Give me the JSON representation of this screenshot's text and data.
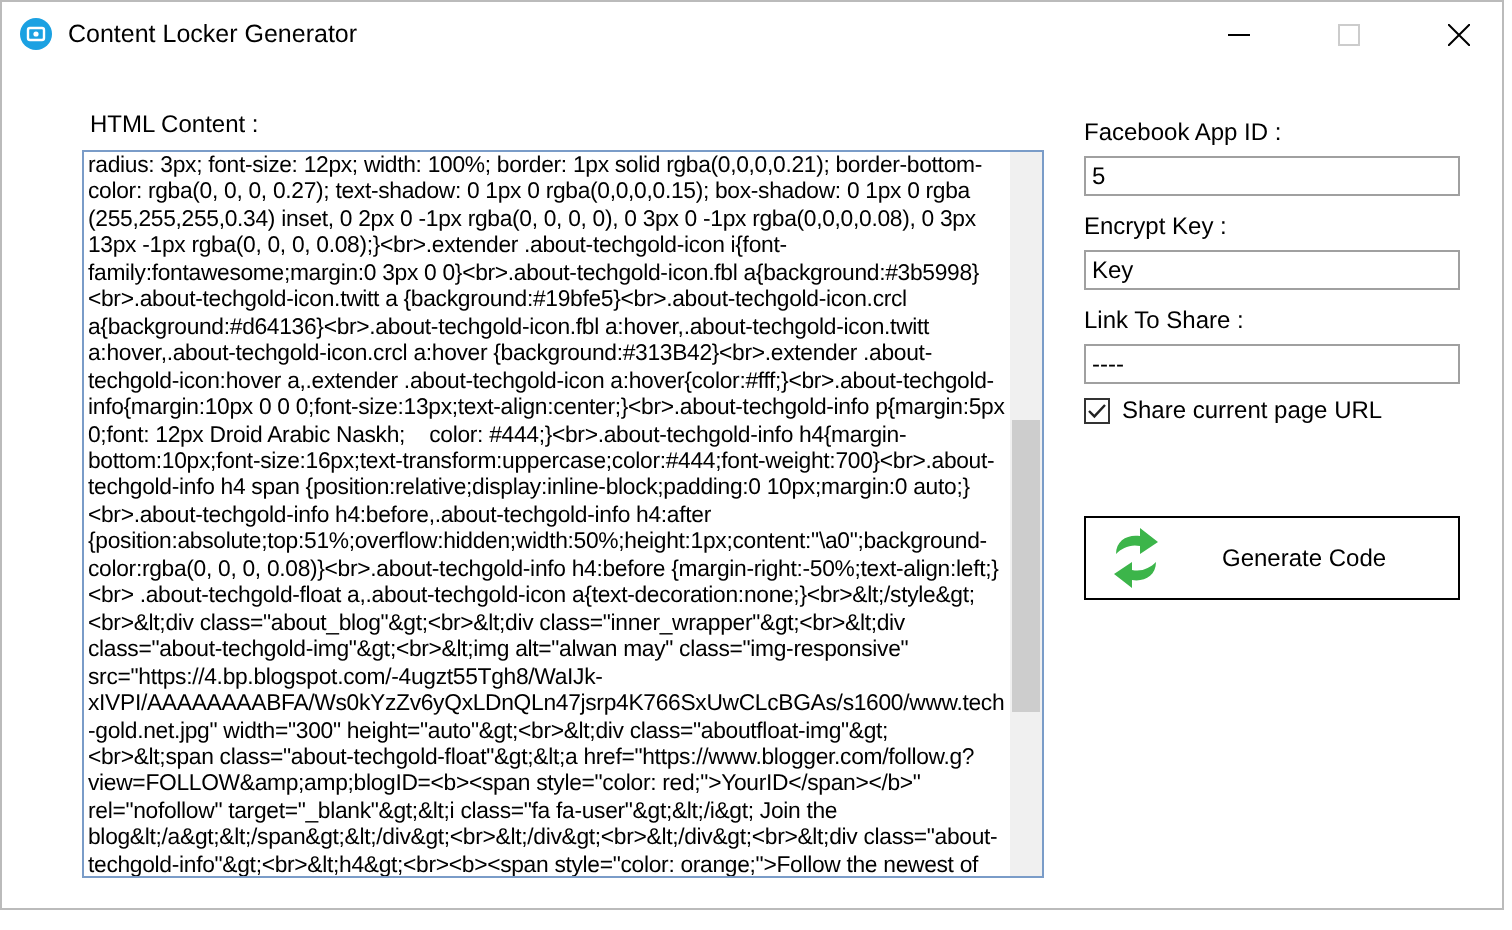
{
  "window": {
    "title": "Content Locker Generator"
  },
  "html_content": {
    "label": "HTML Content :",
    "value": "radius: 3px; font-size: 12px; width: 100%; border: 1px solid rgba(0,0,0,0.21); border-bottom-color: rgba(0, 0, 0, 0.27); text-shadow: 0 1px 0 rgba(0,0,0,0.15); box-shadow: 0 1px 0 rgba (255,255,255,0.34) inset, 0 2px 0 -1px rgba(0, 0, 0, 0), 0 3px 0 -1px rgba(0,0,0,0.08), 0 3px 13px -1px rgba(0, 0, 0, 0.08);}<br>.extender .about-techgold-icon i{font-family:fontawesome;margin:0 3px 0 0}<br>.about-techgold-icon.fbl a{background:#3b5998}<br>.about-techgold-icon.twitt a {background:#19bfe5}<br>.about-techgold-icon.crcl a{background:#d64136}<br>.about-techgold-icon.fbl a:hover,.about-techgold-icon.twitt a:hover,.about-techgold-icon.crcl a:hover {background:#313B42}<br>.extender .about-techgold-icon:hover a,.extender .about-techgold-icon a:hover{color:#fff;}<br>.about-techgold-info{margin:10px 0 0 0;font-size:13px;text-align:center;}<br>.about-techgold-info p{margin:5px 0;font: 12px Droid Arabic Naskh;    color: #444;}<br>.about-techgold-info h4{margin-bottom:10px;font-size:16px;text-transform:uppercase;color:#444;font-weight:700}<br>.about-techgold-info h4 span {position:relative;display:inline-block;padding:0 10px;margin:0 auto;}<br>.about-techgold-info h4:before,.about-techgold-info h4:after {position:absolute;top:51%;overflow:hidden;width:50%;height:1px;content:\"\\a0\";background-color:rgba(0, 0, 0, 0.08)}<br>.about-techgold-info h4:before {margin-right:-50%;text-align:left;}<br> .about-techgold-float a,.about-techgold-icon a{text-decoration:none;}<br>&lt;/style&gt;<br>&lt;div class=\"about_blog\"&gt;<br>&lt;div class=\"inner_wrapper\"&gt;<br>&lt;div class=\"about-techgold-img\"&gt;<br>&lt;img alt=\"alwan may\" class=\"img-responsive\" src=\"https://4.bp.blogspot.com/-4ugzt55Tgh8/WaIJk-xIVPI/AAAAAAAABFA/Ws0kYzZv6yQxLDnQLn47jsrp4K766SxUwCLcBGAs/s1600/www.tech-gold.net.jpg\" width=\"300\" height=\"auto\"&gt;<br>&lt;div class=\"aboutfloat-img\"&gt;<br>&lt;span class=\"about-techgold-float\"&gt;&lt;a href=\"https://www.blogger.com/follow.g?view=FOLLOW&amp;amp;blogID=<b><span style=\"color: red;\">YourID</span></b>\" rel=\"nofollow\" target=\"_blank\"&gt;&lt;i class=\"fa fa-user\"&gt;&lt;/i&gt; Join the blog&lt;/a&gt;&lt;/span&gt;&lt;/div&gt;<br>&lt;/div&gt;<br>&lt;/div&gt;<br>&lt;div class=\"about-techgold-info\"&gt;<br>&lt;h4&gt;<br><b><span style=\"color: orange;\">Follow the newest of"
  },
  "fields": [
    {
      "label": "Facebook App ID :",
      "value": "5"
    },
    {
      "label": "Encrypt Key :",
      "value": "Key"
    },
    {
      "label": "Link To Share :",
      "value": "----"
    }
  ],
  "share_current_url": {
    "label": "Share current page URL",
    "checked": true
  },
  "generate_button": {
    "label": "Generate Code"
  }
}
